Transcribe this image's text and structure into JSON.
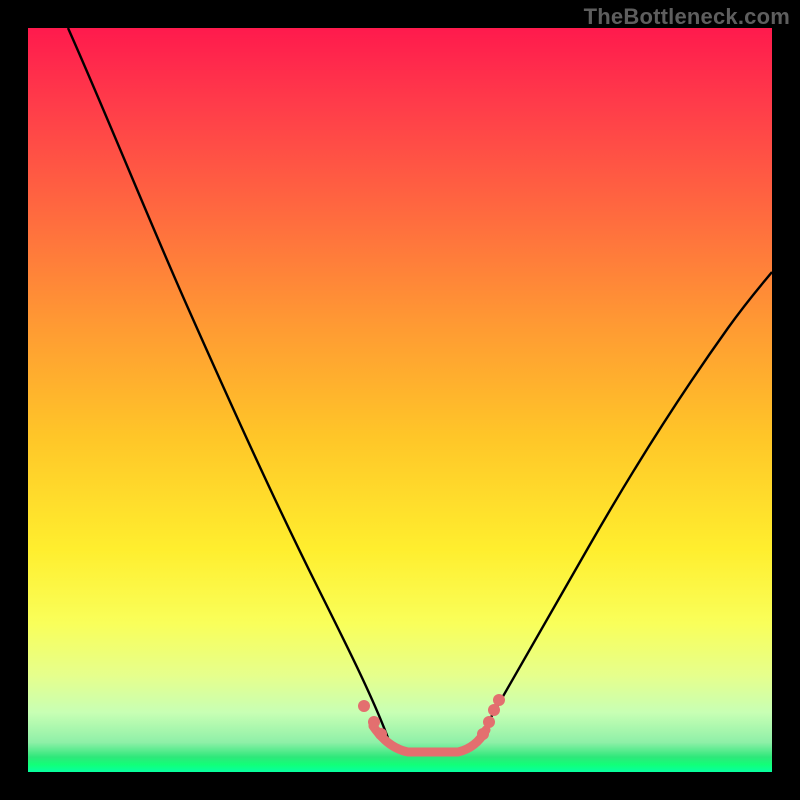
{
  "watermark": "TheBottleneck.com",
  "chart_data": {
    "type": "line",
    "title": "",
    "xlabel": "",
    "ylabel": "",
    "xlim": [
      0,
      100
    ],
    "ylim": [
      0,
      100
    ],
    "legend": false,
    "grid": false,
    "background": "rainbow-vertical-gradient",
    "series": [
      {
        "name": "left-curve",
        "stroke": "#000000",
        "x": [
          5,
          10,
          15,
          20,
          25,
          30,
          35,
          40,
          44,
          46,
          48
        ],
        "y": [
          100,
          88,
          75,
          62,
          49,
          37,
          25,
          14,
          6,
          3,
          1
        ]
      },
      {
        "name": "right-curve",
        "stroke": "#000000",
        "x": [
          60,
          62,
          65,
          70,
          75,
          80,
          85,
          90,
          95,
          100
        ],
        "y": [
          1,
          3,
          6,
          13,
          21,
          30,
          39,
          48,
          56,
          63
        ]
      },
      {
        "name": "valley-floor-markers",
        "stroke": "#e36f6f",
        "marker": "circle",
        "x": [
          46,
          48,
          50,
          52,
          54,
          56,
          58,
          60,
          61,
          62
        ],
        "y": [
          4,
          2,
          1,
          1,
          1,
          1,
          1,
          1.5,
          3,
          5
        ]
      }
    ],
    "annotations": []
  }
}
